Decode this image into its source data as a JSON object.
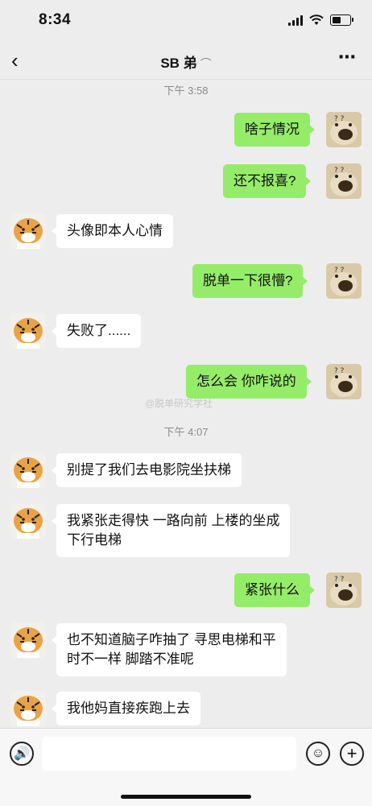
{
  "status": {
    "time": "8:34"
  },
  "header": {
    "title": "SB 弟",
    "ear_icon": "ear-icon",
    "back_icon": "chevron-left-icon",
    "more_icon": "more-icon"
  },
  "timestamps": [
    "下午 3:58",
    "下午 4:07"
  ],
  "messages": [
    {
      "side": "me",
      "text": "啥子情况"
    },
    {
      "side": "me",
      "text": "还不报喜?"
    },
    {
      "side": "them",
      "text": "头像即本人心情"
    },
    {
      "side": "me",
      "text": "脱单一下很懵?"
    },
    {
      "side": "them",
      "text": "失败了......"
    },
    {
      "side": "me",
      "text": "怎么会 你咋说的"
    },
    {
      "side": "them",
      "text": "别提了我们去电影院坐扶梯"
    },
    {
      "side": "them",
      "text": "我紧张走得快 一路向前 上楼的坐成\n下行电梯"
    },
    {
      "side": "me",
      "text": "紧张什么"
    },
    {
      "side": "them",
      "text": " 也不知道脑子咋抽了 寻思电梯和平\n时不一样 脚踏不准呢"
    },
    {
      "side": "them",
      "text": "我他妈直接疾跑上去"
    }
  ],
  "watermark": "@脱单研究学社",
  "input": {
    "value": "",
    "voice_icon": "voice-icon",
    "emoji_icon": "emoji-icon",
    "plus_icon": "plus-icon"
  },
  "colors": {
    "my_bubble": "#95ec69",
    "their_bubble": "#ffffff",
    "background": "#ededed"
  }
}
